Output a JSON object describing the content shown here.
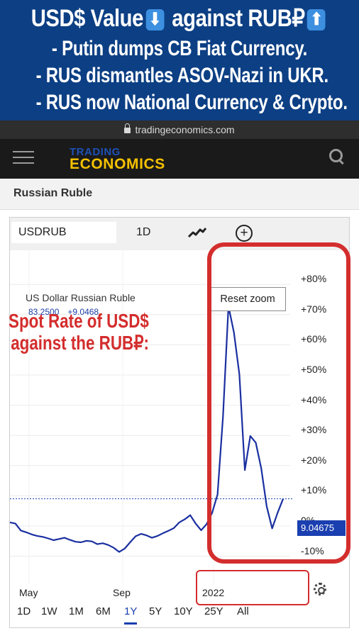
{
  "banner": {
    "line1_pre": "USD$ Value",
    "line1_mid": " against RUB₽",
    "arrow_down": "⬇",
    "arrow_up": "⬆",
    "line2": "- Putin dumps CB Fiat Currency.",
    "line3": "- RUS dismantles ASOV-Nazi in UKR.",
    "line4": "- RUS now National Currency & Crypto.",
    "color": "#0c3f84"
  },
  "browser": {
    "url": "tradingeconomics.com"
  },
  "site": {
    "logo_top": "TRADING",
    "logo_bottom": "ECONOMICS",
    "menu_icon": "hamburger-icon",
    "search_icon": "search-icon",
    "page_title": "Russian Ruble"
  },
  "toolbar": {
    "symbol": "USDRUB",
    "timeframe": "1D",
    "chart_type_icon": "line-chart-icon",
    "add_icon": "plus-circle-icon"
  },
  "chart": {
    "reset_zoom": "Reset zoom",
    "series_name": "US Dollar Russian Ruble",
    "last_value": "83.2500",
    "change": "+9.0468",
    "current_flag": "9.04675",
    "line_color": "#1a2fa0",
    "flag_color": "#1a3fb0",
    "periods": [
      "1D",
      "1W",
      "1M",
      "6M",
      "1Y",
      "5Y",
      "10Y",
      "25Y",
      "All"
    ],
    "active_period": "1Y",
    "settings_icon": "gear-icon"
  },
  "annotations": {
    "line1": "Spot Rate of USD$",
    "line2": "against the RUB₽:",
    "color": "#d42d2d"
  },
  "chart_data": {
    "type": "line",
    "series": [
      {
        "name": "US Dollar Russian Ruble",
        "x_index": [
          0,
          2,
          4,
          6,
          8,
          10,
          12,
          14,
          16,
          18,
          20,
          22,
          24,
          26,
          28,
          30,
          32,
          34,
          36,
          38,
          40,
          42,
          44,
          46,
          48,
          50,
          52,
          54,
          56,
          58,
          60,
          62,
          64,
          66,
          68,
          70,
          72,
          74,
          76,
          78,
          80,
          82,
          84,
          86,
          88,
          90,
          92,
          94,
          96,
          98,
          100
        ],
        "values": [
          1.2,
          0.8,
          -1.5,
          -2.1,
          -2.8,
          -3.3,
          -3.6,
          -4.1,
          -4.7,
          -4.3,
          -3.9,
          -4.6,
          -5.2,
          -5.4,
          -4.9,
          -5.1,
          -6.0,
          -5.7,
          -6.3,
          -7.2,
          -8.6,
          -7.5,
          -5.4,
          -3.4,
          -2.6,
          -3.1,
          -3.9,
          -3.3,
          -2.4,
          -1.6,
          -0.7,
          1.2,
          2.2,
          3.6,
          0.8,
          -1.4,
          0.6,
          4.3,
          10.4,
          36.2,
          72.8,
          64.1,
          50.2,
          18.5,
          29.8,
          27.6,
          19.1,
          6.5,
          -0.8,
          4.4,
          9.0
        ]
      }
    ],
    "xticks": [
      "May",
      "Sep",
      "2022"
    ],
    "yticks": [
      "+80%",
      "+70%",
      "+60%",
      "+50%",
      "+40%",
      "+30%",
      "+20%",
      "+10%",
      "0%",
      "-10%"
    ],
    "ylim": [
      -12,
      84
    ],
    "grid": true,
    "legend": "top-left"
  }
}
